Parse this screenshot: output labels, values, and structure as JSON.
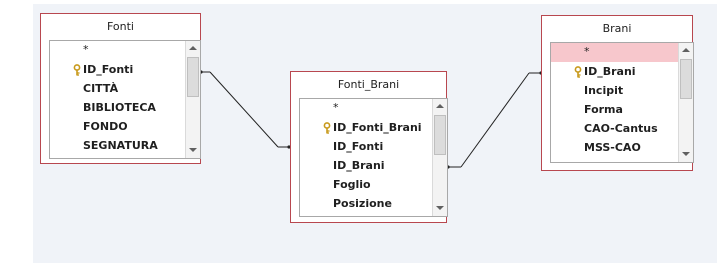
{
  "tables": {
    "fonti": {
      "title": "Fonti",
      "fields": [
        "*",
        "ID_Fonti",
        "CITTÀ",
        "BIBLIOTECA",
        "FONDO",
        "SEGNATURA"
      ]
    },
    "fonti_brani": {
      "title": "Fonti_Brani",
      "fields": [
        "*",
        "ID_Fonti_Brani",
        "ID_Fonti",
        "ID_Brani",
        "Foglio",
        "Posizione"
      ]
    },
    "brani": {
      "title": "Brani",
      "fields": [
        "*",
        "ID_Brani",
        "Incipit",
        "Forma",
        "CAO-Cantus",
        "MSS-CAO"
      ]
    }
  },
  "primary_keys": {
    "fonti": "ID_Fonti",
    "fonti_brani": "ID_Fonti_Brani",
    "brani": "ID_Brani"
  },
  "icons": {
    "key": "key-icon",
    "scroll_up": "scroll-up-arrow-icon",
    "scroll_down": "scroll-down-arrow-icon"
  },
  "colors": {
    "window_border": "#b8474f",
    "selection": "#f7c7cc",
    "canvas_background": "#f0f3f8",
    "relationship_line": "#222222"
  }
}
